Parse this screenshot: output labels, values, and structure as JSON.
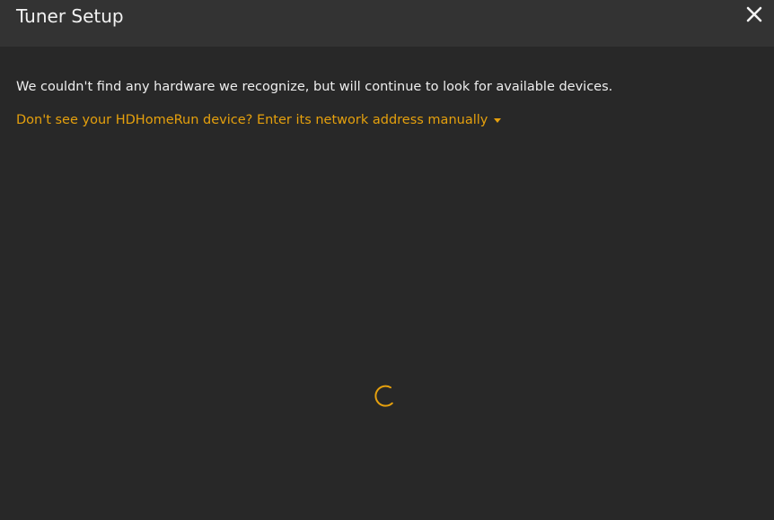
{
  "dialog": {
    "title": "Tuner Setup",
    "close_icon": "close-icon"
  },
  "main": {
    "message": "We couldn't find any hardware we recognize, but will continue to look for available devices.",
    "manual_link": "Don't see your HDHomeRun device? Enter its network address manually",
    "manual_link_icon": "caret-down-icon",
    "loading_icon": "loading-spinner-icon"
  },
  "colors": {
    "background": "#282828",
    "header": "#333333",
    "accent": "#e5a00d",
    "text": "#eeeeee"
  }
}
